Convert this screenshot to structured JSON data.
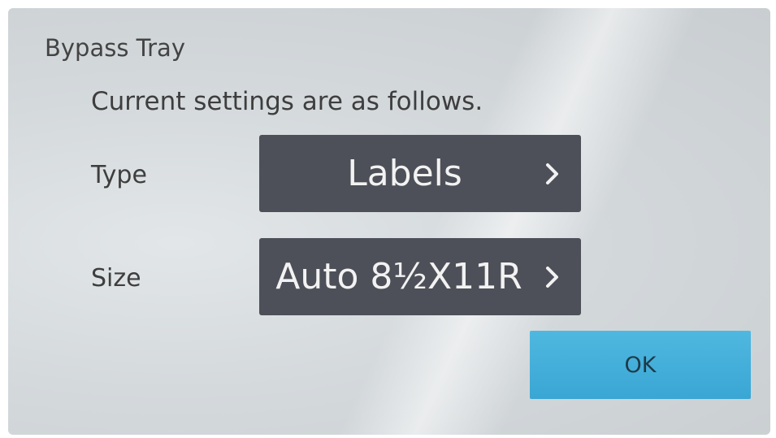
{
  "dialog": {
    "title": "Bypass Tray",
    "subtitle": "Current settings are as follows."
  },
  "settings": {
    "type": {
      "label": "Type",
      "value": "Labels"
    },
    "size": {
      "label": "Size",
      "value": "Auto 8½X11R"
    }
  },
  "actions": {
    "ok_label": "OK"
  },
  "colors": {
    "setting_button": "#4d5058",
    "ok_button": "#3aa6d4"
  }
}
